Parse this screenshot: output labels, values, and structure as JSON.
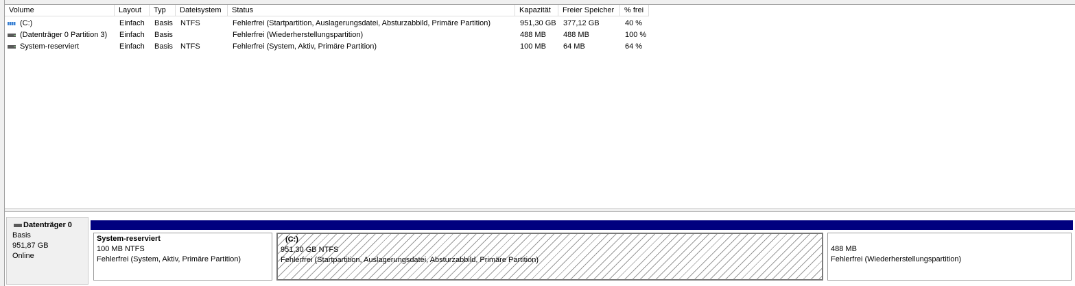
{
  "volume_list": {
    "columns": [
      "Volume",
      "Layout",
      "Typ",
      "Dateisystem",
      "Status",
      "Kapazität",
      "Freier Speicher",
      "% frei"
    ],
    "rows": [
      {
        "icon": "drive-icon-blue",
        "volume": "(C:)",
        "layout": "Einfach",
        "typ": "Basis",
        "dateisystem": "NTFS",
        "status": "Fehlerfrei (Startpartition, Auslagerungsdatei, Absturzabbild, Primäre Partition)",
        "kapazitaet": "951,30 GB",
        "frei": "377,12 GB",
        "prozent": "40 %"
      },
      {
        "icon": "drive-icon",
        "volume": "(Datenträger 0 Partition 3)",
        "layout": "Einfach",
        "typ": "Basis",
        "dateisystem": "",
        "status": "Fehlerfrei (Wiederherstellungspartition)",
        "kapazitaet": "488 MB",
        "frei": "488 MB",
        "prozent": "100 %"
      },
      {
        "icon": "drive-icon",
        "volume": "System-reserviert",
        "layout": "Einfach",
        "typ": "Basis",
        "dateisystem": "NTFS",
        "status": "Fehlerfrei (System, Aktiv, Primäre Partition)",
        "kapazitaet": "100 MB",
        "frei": "64 MB",
        "prozent": "64 %"
      }
    ]
  },
  "disk": {
    "name": "Datenträger 0",
    "type": "Basis",
    "size": "951,87 GB",
    "state": "Online",
    "partitions": [
      {
        "name": "System-reserviert",
        "size_fs": "100 MB NTFS",
        "status": "Fehlerfrei (System, Aktiv, Primäre Partition)"
      },
      {
        "name": "(C:)",
        "size_fs": "951,30 GB NTFS",
        "status": "Fehlerfrei (Startpartition, Auslagerungsdatei, Absturzabbild, Primäre Partition)"
      },
      {
        "name": "",
        "size_fs": "488 MB",
        "status": "Fehlerfrei (Wiederherstellungspartition)"
      }
    ]
  },
  "colors": {
    "partition_bar": "#00007f",
    "window_bg": "#f0f0f0"
  }
}
